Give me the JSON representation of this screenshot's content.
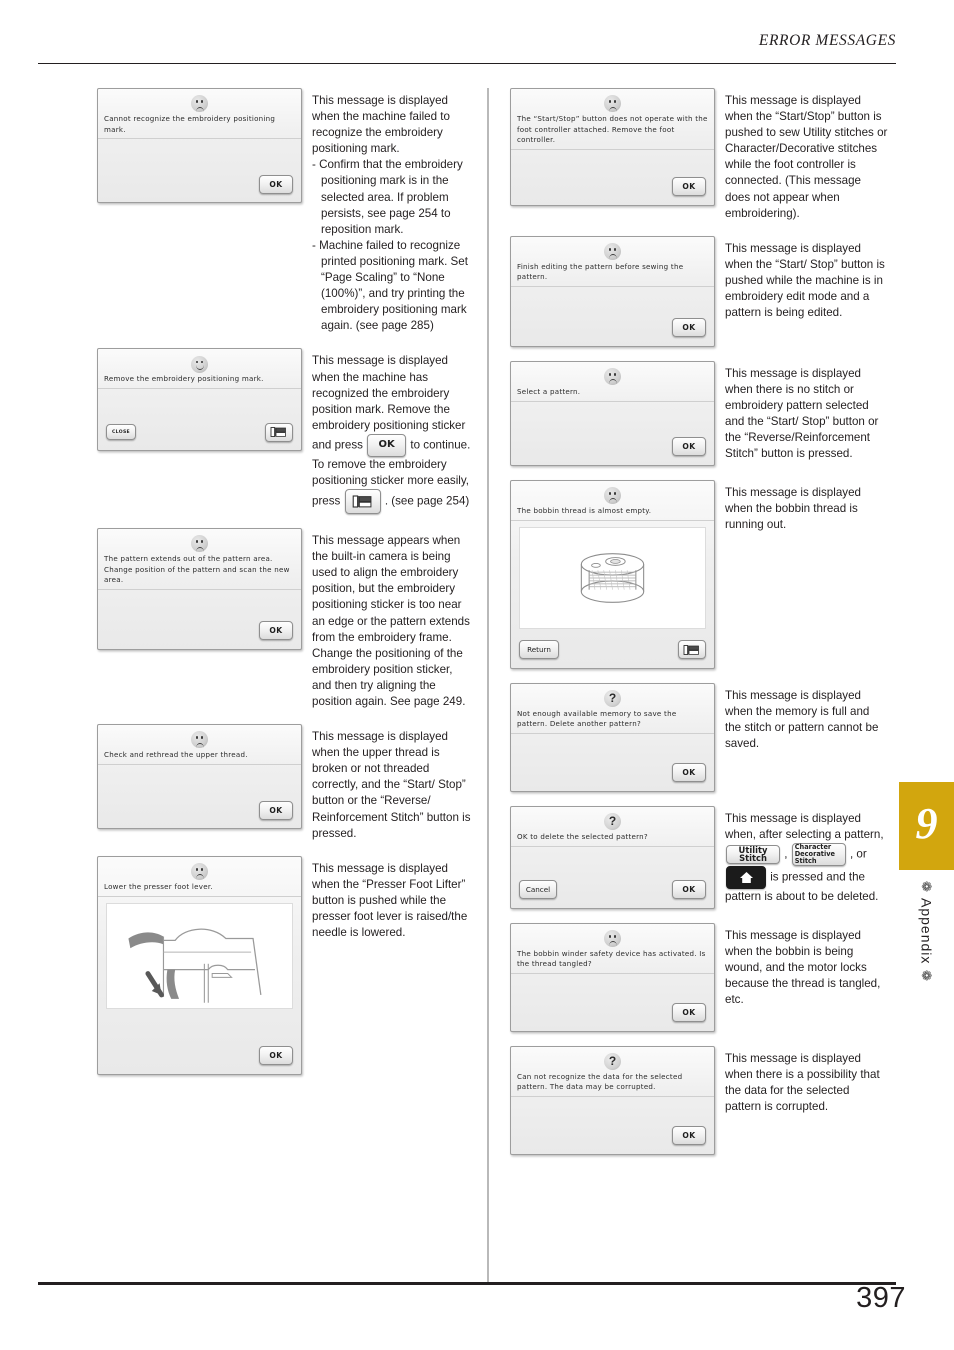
{
  "header": {
    "title": "ERROR MESSAGES"
  },
  "footer": {
    "page_number": "397"
  },
  "chapter_tab": {
    "number": "9",
    "label": "Appendix",
    "color": "#d2a60e",
    "ornament": "❁"
  },
  "buttons": {
    "ok": "OK",
    "cancel": "Cancel",
    "close": "CLOSE",
    "return": "Return",
    "utility_stitch_line1": "Utility",
    "utility_stitch_line2": "Stitch",
    "char_deco_line1": "Character",
    "char_deco_line2": "Decorative",
    "char_deco_line3": "Stitch"
  },
  "left_column": [
    {
      "id": "cannot-recognize-mark",
      "dialog_message": "Cannot recognize the embroidery positioning mark.",
      "face": "sad",
      "note_paragraphs": [
        "This message is displayed when the machine failed to recognize the embroidery positioning mark.",
        "- Confirm that the embroidery positioning mark is in the selected area. If problem persists, see page 254 to reposition mark.",
        "- Machine failed to recognize printed positioning mark. Set “Page Scaling” to “None (100%)”, and try printing the embroidery positioning mark again. (see page 285)"
      ]
    },
    {
      "id": "remove-mark",
      "dialog_message": "Remove the embroidery positioning mark.",
      "face": "happy",
      "note_parts": {
        "part1": "This message is displayed when the machine has recognized the embroidery position mark. Remove the embroidery positioning sticker and press",
        "part2": "to continue. To remove the embroidery positioning sticker more easily, press",
        "part3": ". (see page 254)"
      }
    },
    {
      "id": "pattern-extends-out",
      "dialog_message": "The pattern extends out of the pattern area. Change position of the pattern and scan the new area.",
      "face": "sad",
      "note_paragraphs": [
        "This message appears when the built-in camera is being used to align the embroidery position, but the embroidery positioning sticker is too near an edge or the pattern extends from the embroidery frame. Change the positioning of the embroidery position sticker, and then try aligning the position again. See page 249."
      ]
    },
    {
      "id": "rethread-upper-thread",
      "dialog_message": "Check and rethread the upper thread.",
      "face": "sad",
      "note_paragraphs": [
        "This message is displayed when the upper thread is broken or not threaded correctly, and the “Start/ Stop” button or the “Reverse/ Reinforcement Stitch” button is pressed."
      ]
    },
    {
      "id": "lower-presser-foot",
      "dialog_message": "Lower the presser foot lever.",
      "face": "sad",
      "note_paragraphs": [
        "This message is displayed when the “Presser Foot Lifter” button is pushed while the presser foot lever is raised/the needle is lowered."
      ]
    }
  ],
  "right_column": [
    {
      "id": "foot-controller-attached",
      "dialog_message": "The “Start/Stop” button does not operate with the foot controller attached. Remove the foot controller.",
      "face": "sad",
      "note_paragraphs": [
        "This message is displayed when the “Start/Stop” button is pushed to sew Utility stitches or Character/Decorative stitches while the foot controller is connected. (This message does not appear when embroidering)."
      ]
    },
    {
      "id": "finish-editing-pattern",
      "dialog_message": "Finish editing the pattern before sewing the pattern.",
      "face": "sad",
      "note_paragraphs": [
        "This message is displayed when the “Start/ Stop” button is pushed while the machine is in embroidery edit mode and a pattern is being edited."
      ]
    },
    {
      "id": "select-a-pattern",
      "dialog_message": "Select a pattern.",
      "face": "sad",
      "note_paragraphs": [
        "This message is displayed when there is no stitch or embroidery pattern selected and the “Start/ Stop” button or the “Reverse/Reinforcement Stitch” button is pressed."
      ]
    },
    {
      "id": "bobbin-thread-almost-empty",
      "dialog_message": "The bobbin thread is almost empty.",
      "face": "sad",
      "note_paragraphs": [
        "This message is displayed when the bobbin thread is running out."
      ]
    },
    {
      "id": "not-enough-memory",
      "dialog_message": "Not enough available memory to save the pattern. Delete another pattern?",
      "face": "question",
      "note_paragraphs": [
        "This message is displayed when the memory is full and the stitch or pattern cannot be saved."
      ]
    },
    {
      "id": "ok-to-delete-pattern",
      "dialog_message": "OK to delete the selected pattern?",
      "face": "question",
      "note_parts": {
        "part1": "This message is displayed when, after selecting a pattern,",
        "part2": ",",
        "part3": ", or",
        "part4": "is pressed and the pattern is about to be deleted."
      }
    },
    {
      "id": "bobbin-winder-safety",
      "dialog_message": "The bobbin winder safety device has activated. Is the thread tangled?",
      "face": "sad",
      "note_paragraphs": [
        "This message is displayed when the bobbin is being wound, and the motor locks because the thread is tangled, etc."
      ]
    },
    {
      "id": "cannot-recognize-data",
      "dialog_message": "Can not recognize the data for the selected pattern. The data may be corrupted.",
      "face": "question",
      "note_paragraphs": [
        "This message is displayed when there is a possibility that the data for the selected pattern is corrupted."
      ]
    }
  ]
}
